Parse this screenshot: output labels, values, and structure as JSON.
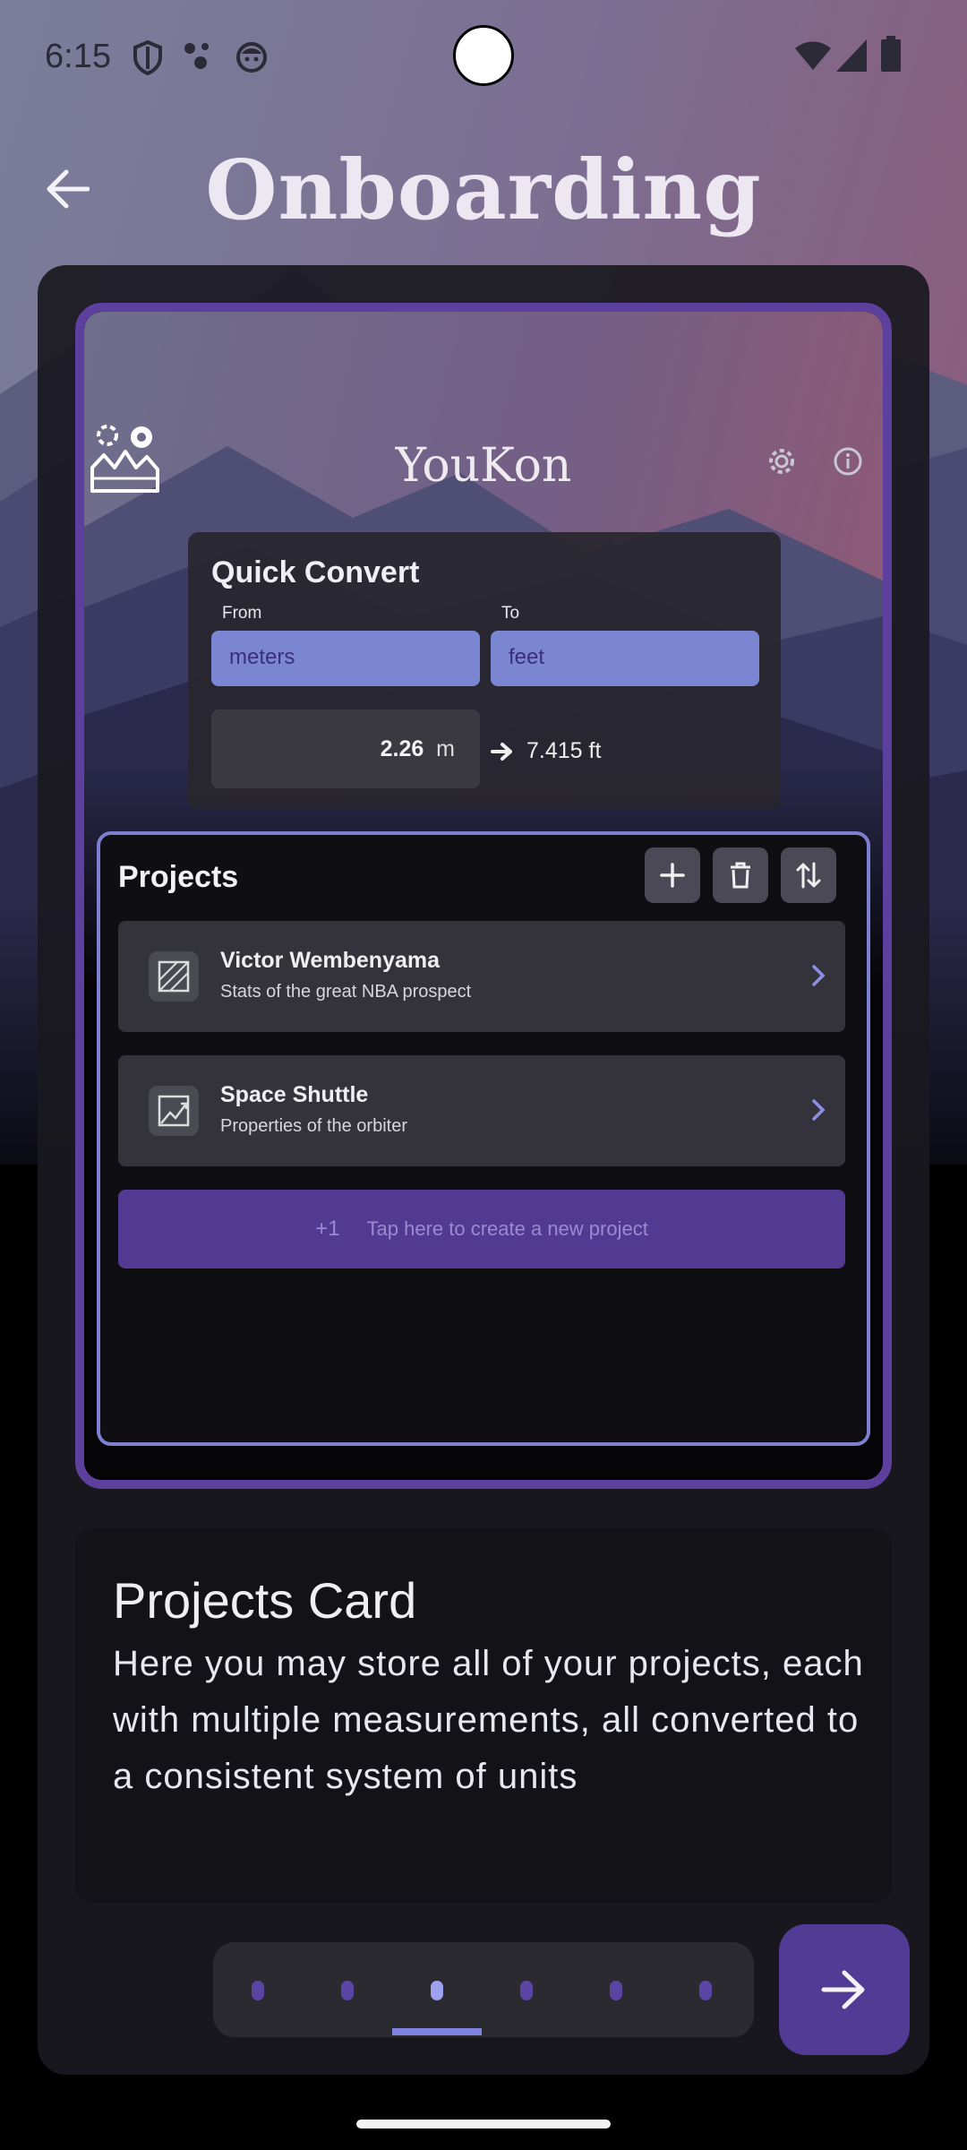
{
  "status_bar": {
    "time": "6:15"
  },
  "header": {
    "title": "Onboarding"
  },
  "preview": {
    "app_title": "YouKon",
    "quick_convert": {
      "title": "Quick Convert",
      "from_label": "From",
      "to_label": "To",
      "from_unit": "meters",
      "to_unit": "feet",
      "input_value": "2.26",
      "input_unit": "m",
      "result": "7.415 ft"
    },
    "projects": {
      "title": "Projects",
      "items": [
        {
          "name": "Victor Wembenyama",
          "description": "Stats of the great NBA prospect"
        },
        {
          "name": "Space Shuttle",
          "description": "Properties of the orbiter"
        }
      ],
      "new_project_icon": "+1",
      "new_project_label": "Tap here to create a new project"
    }
  },
  "description": {
    "title": "Projects Card",
    "body": "Here you may store all of your projects, each with multiple measurements, all converted to a consistent system of units"
  },
  "pager": {
    "page_count": 6,
    "current_page": 3
  },
  "colors": {
    "accent": "#513b94",
    "frame": "#5d3f9e",
    "field": "#7b86d3",
    "highlight": "#7e83df"
  }
}
